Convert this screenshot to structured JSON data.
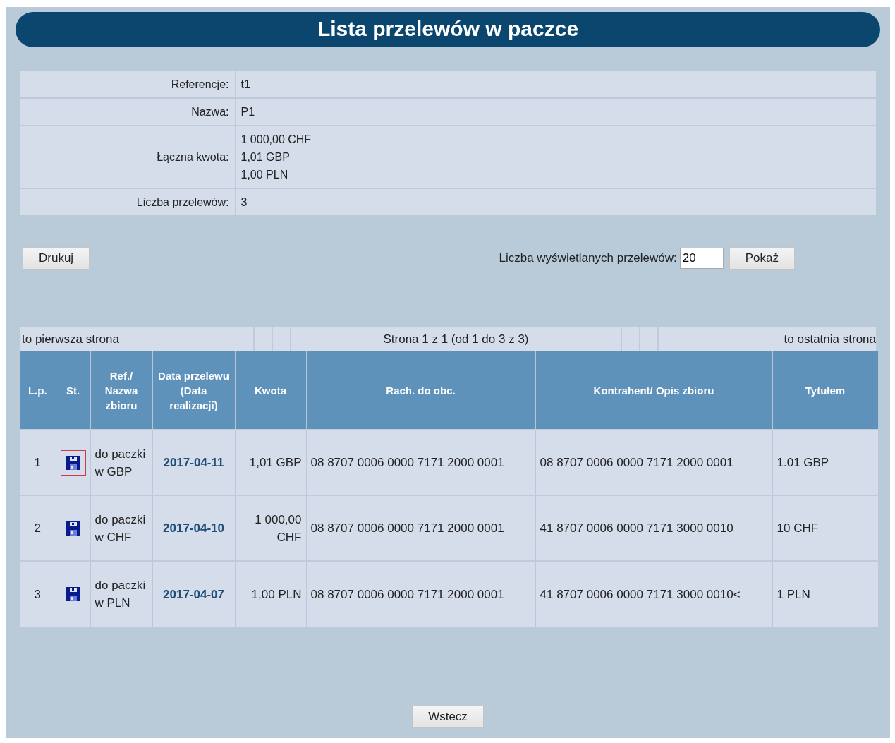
{
  "title": "Lista przelewów w paczce",
  "details": [
    {
      "label": "Referencje:",
      "values": [
        "t1"
      ]
    },
    {
      "label": "Nazwa:",
      "values": [
        "P1"
      ]
    },
    {
      "label": "Łączna kwota:",
      "values": [
        "1 000,00 CHF",
        "1,01 GBP",
        "1,00 PLN"
      ]
    },
    {
      "label": "Liczba przelewów:",
      "values": [
        "3"
      ]
    }
  ],
  "print_button": "Drukuj",
  "page_size": {
    "label": "Liczba wyświetlanych przelewów:",
    "value": "20",
    "button": "Pokaż"
  },
  "pagination": {
    "first": "to pierwsza strona",
    "info": "Strona 1 z 1 (od 1 do 3 z 3)",
    "last": "to ostatnia strona"
  },
  "table": {
    "columns": [
      "L.p.",
      "St.",
      "Ref./ Nazwa zbioru",
      "Data przelewu (Data realizacji)",
      "Kwota",
      "Rach. do obc.",
      "Kontrahent/ Opis zbioru",
      "Tytułem"
    ],
    "rows": [
      {
        "lp": "1",
        "selected": true,
        "ref": "do paczki w GBP",
        "date": "2017-04-11",
        "amount": "1,01 GBP",
        "debit_account": "08 8707 0006 0000 7171 2000 0001",
        "counterparty": "08 8707 0006 0000 7171 2000 0001",
        "title": "1.01 GBP"
      },
      {
        "lp": "2",
        "selected": false,
        "ref": "do paczki w CHF",
        "date": "2017-04-10",
        "amount": "1 000,00 CHF",
        "debit_account": "08 8707 0006 0000 7171 2000 0001",
        "counterparty": "41 8707 0006 0000 7171 3000 0010",
        "title": "10 CHF"
      },
      {
        "lp": "3",
        "selected": false,
        "ref": "do paczki w PLN",
        "date": "2017-04-07",
        "amount": "1,00 PLN",
        "debit_account": "08 8707 0006 0000 7171 2000 0001",
        "counterparty": "41 8707 0006 0000 7171 3000 0010<",
        "title": "1 PLN"
      }
    ]
  },
  "back_button": "Wstecz"
}
